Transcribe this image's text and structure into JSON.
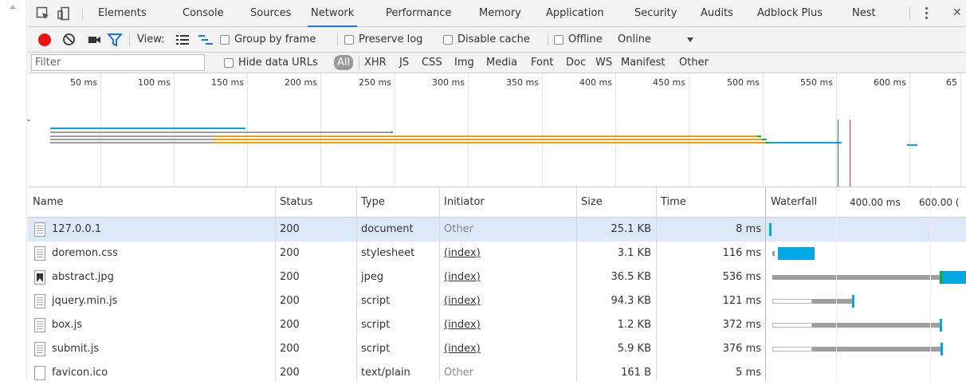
{
  "tabs": [
    {
      "label": "Elements",
      "active": false
    },
    {
      "label": "Console",
      "active": false
    },
    {
      "label": "Sources",
      "active": false
    },
    {
      "label": "Network",
      "active": true
    },
    {
      "label": "Performance",
      "active": false
    },
    {
      "label": "Memory",
      "active": false
    },
    {
      "label": "Application",
      "active": false
    },
    {
      "label": "Security",
      "active": false
    },
    {
      "label": "Audits",
      "active": false
    },
    {
      "label": "Adblock Plus",
      "active": false
    },
    {
      "label": "Nest",
      "active": false
    }
  ],
  "toolbar": {
    "view_label": "View:",
    "group_by_frame": "Group by frame",
    "preserve_log": "Preserve log",
    "disable_cache": "Disable cache",
    "offline": "Offline",
    "throttle_value": "Online"
  },
  "filter": {
    "placeholder": "Filter",
    "hide_data_urls": "Hide data URLs",
    "types": [
      "All",
      "XHR",
      "JS",
      "CSS",
      "Img",
      "Media",
      "Font",
      "Doc",
      "WS",
      "Manifest",
      "Other"
    ]
  },
  "overview": {
    "ticks": [
      "50 ms",
      "100 ms",
      "150 ms",
      "200 ms",
      "250 ms",
      "300 ms",
      "350 ms",
      "400 ms",
      "450 ms",
      "500 ms",
      "550 ms",
      "600 ms",
      "65"
    ]
  },
  "columns": {
    "name": "Name",
    "status": "Status",
    "type": "Type",
    "initiator": "Initiator",
    "size": "Size",
    "time": "Time",
    "waterfall": "Waterfall",
    "wf_tick_1": "400.00 ms",
    "wf_tick_2": "600.00 ("
  },
  "requests": [
    {
      "name": "127.0.0.1",
      "status": "200",
      "type": "document",
      "initiator": "Other",
      "initiator_link": false,
      "size": "25.1 KB",
      "time": "8 ms",
      "icon": "document-icon"
    },
    {
      "name": "doremon.css",
      "status": "200",
      "type": "stylesheet",
      "initiator": "(index)",
      "initiator_link": true,
      "size": "3.1 KB",
      "time": "116 ms",
      "icon": "document-icon"
    },
    {
      "name": "abstract.jpg",
      "status": "200",
      "type": "jpeg",
      "initiator": "(index)",
      "initiator_link": true,
      "size": "36.5 KB",
      "time": "536 ms",
      "icon": "image-icon"
    },
    {
      "name": "jquery.min.js",
      "status": "200",
      "type": "script",
      "initiator": "(index)",
      "initiator_link": true,
      "size": "94.3 KB",
      "time": "121 ms",
      "icon": "document-icon"
    },
    {
      "name": "box.js",
      "status": "200",
      "type": "script",
      "initiator": "(index)",
      "initiator_link": true,
      "size": "1.2 KB",
      "time": "372 ms",
      "icon": "document-icon"
    },
    {
      "name": "submit.js",
      "status": "200",
      "type": "script",
      "initiator": "(index)",
      "initiator_link": true,
      "size": "5.9 KB",
      "time": "376 ms",
      "icon": "document-icon"
    },
    {
      "name": "favicon.ico",
      "status": "200",
      "type": "text/plain",
      "initiator": "Other",
      "initiator_link": false,
      "size": "161 B",
      "time": "5 ms",
      "icon": "blank-file-icon"
    }
  ],
  "colors": {
    "record": "#e11",
    "accent": "#1a73e8",
    "selected_row": "#dbe9f8",
    "download": "#00a8e8",
    "waiting": "#9e9e9e",
    "ttfb": "#00b050",
    "orange": "#f39c12"
  }
}
